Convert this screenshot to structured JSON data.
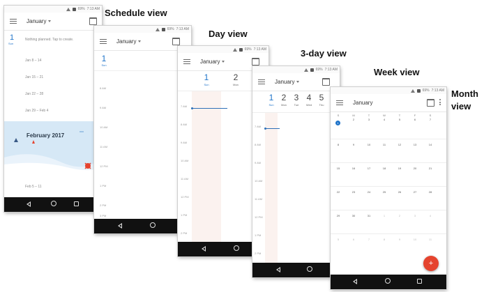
{
  "labels": {
    "schedule": "Schedule view",
    "day": "Day view",
    "three_day": "3-day view",
    "week": "Week view",
    "month_line1": "Month",
    "month_line2": "view"
  },
  "status": {
    "battery": "69%",
    "time": "7:13 AM"
  },
  "app": {
    "month_title": "January"
  },
  "schedule": {
    "today_num": "1",
    "today_day": "Sun",
    "today_note": "Nothing planned. Tap to create.",
    "weeks": [
      "Jan 8 – 14",
      "Jan 15 – 21",
      "Jan 22 – 28",
      "Jan 29 – Feb 4"
    ],
    "banner_title": "February 2017",
    "after_banner": "Feb 5 – 11"
  },
  "day": {
    "day_num": "1",
    "day_name": "Sun",
    "times": [
      "8 AM",
      "9 AM",
      "10 AM",
      "11 AM",
      "12 PM",
      "1 PM",
      "2 PM",
      "3 PM"
    ]
  },
  "three_day": {
    "days": [
      {
        "num": "1",
        "name": "Sun"
      },
      {
        "num": "2",
        "name": "Mon"
      }
    ],
    "times": [
      "7 AM",
      "8 AM",
      "9 AM",
      "10 AM",
      "11 AM",
      "12 PM",
      "1 PM",
      "2 PM"
    ]
  },
  "week": {
    "days": [
      {
        "num": "1",
        "name": "Sun"
      },
      {
        "num": "2",
        "name": "Mon"
      },
      {
        "num": "3",
        "name": "Tue"
      },
      {
        "num": "4",
        "name": "Wed"
      },
      {
        "num": "5",
        "name": "Thu"
      }
    ],
    "times": [
      "7 AM",
      "8 AM",
      "9 AM",
      "10 AM",
      "11 AM",
      "12 PM",
      "1 PM",
      "2 PM"
    ]
  },
  "month": {
    "weekday_headers": [
      "S",
      "M",
      "T",
      "W",
      "T",
      "F",
      "S"
    ],
    "weeks": [
      [
        "1",
        "2",
        "3",
        "4",
        "5",
        "6",
        "7"
      ],
      [
        "8",
        "9",
        "10",
        "11",
        "12",
        "13",
        "14"
      ],
      [
        "15",
        "16",
        "17",
        "18",
        "19",
        "20",
        "21"
      ],
      [
        "22",
        "23",
        "24",
        "25",
        "26",
        "27",
        "28"
      ],
      [
        "29",
        "30",
        "31",
        "1",
        "2",
        "3",
        "4"
      ],
      [
        "5",
        "6",
        "7",
        "8",
        "9",
        "10",
        "11"
      ]
    ],
    "fab_label": "+"
  },
  "colors": {
    "accent": "#1e73c9",
    "fab": "#e5432e",
    "banner": "#d6e8f6",
    "navbar": "#111111"
  }
}
